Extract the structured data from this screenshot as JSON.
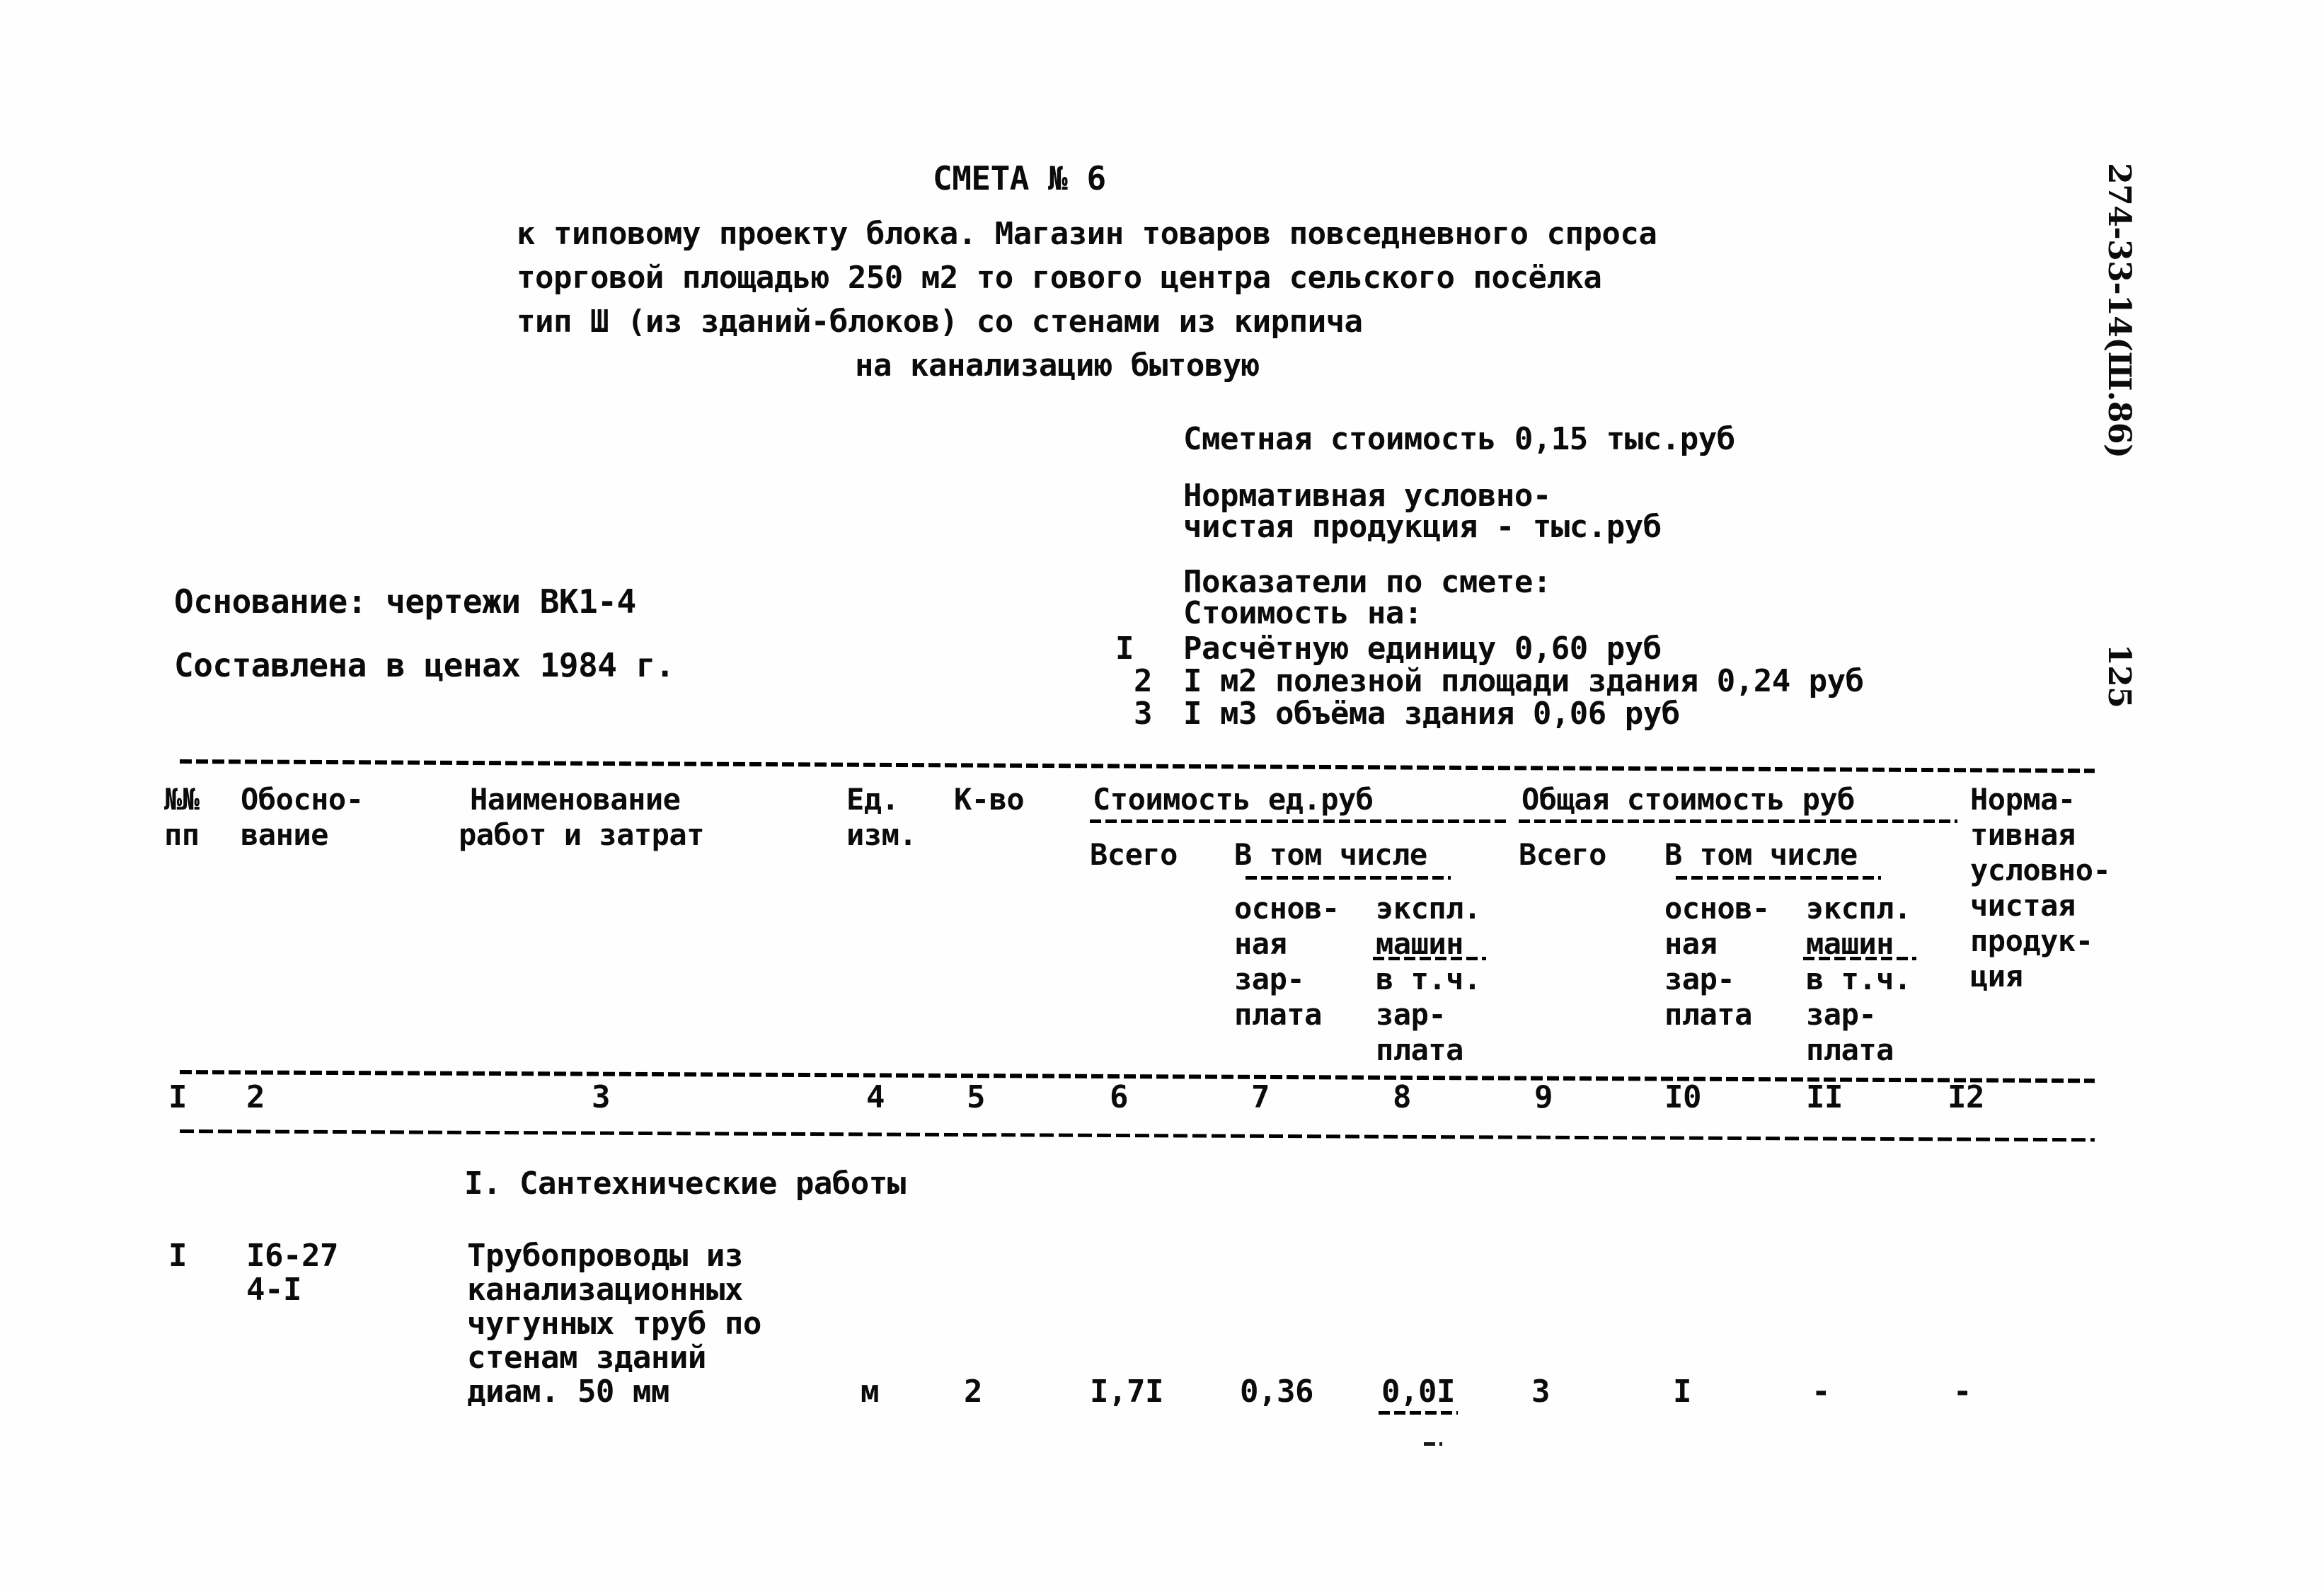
{
  "document": {
    "heading": "СМЕТА № 6",
    "subtitle_lines": [
      "к типовому проекту блока. Магазин товаров повседневного спроса",
      "торговой площадью 250 м2 то гового центра сельского посёлка",
      "тип Ш (из зданий-блоков) со стенами из кирпича"
    ],
    "subtitle_centered_line": "на канализацию бытовую",
    "side_code": "274-33-14(Ш.86)",
    "page_number": "125"
  },
  "basis": {
    "osnovanie": "Основание: чертежи ВК1-4",
    "prices": "Составлена в ценах 1984 г."
  },
  "summary": {
    "estimate_cost": "Сметная стоимость 0,15 тыс.руб",
    "npp_line1": "Нормативная условно-",
    "npp_line2": "чистая продукция - тыс.руб",
    "indicators_title": "Показатели по смете:",
    "cost_on": "Стоимость на:",
    "items": [
      {
        "no": "I",
        "text": "Расчётную единицу 0,60 руб"
      },
      {
        "no": "2",
        "text": "I м2 полезной площади здания 0,24 руб"
      },
      {
        "no": "3",
        "text": "I м3 объёма здания 0,06 руб"
      }
    ]
  },
  "table": {
    "headers": {
      "no_l1": "№№",
      "no_l2": "пп",
      "basis_l1": "Обосно-",
      "basis_l2": "вание",
      "name_l1": "Наименование",
      "name_l2": "работ и затрат",
      "unit_l1": "Ед.",
      "unit_l2": "изм.",
      "qty": "К-во",
      "group_unit_cost": "Стоимость ед.руб",
      "group_total_cost": "Общая стоимость руб",
      "total_1": "Всего",
      "incl_1": "В том числе",
      "total_2": "Всего",
      "incl_2": "В том числе",
      "sub_main_l1": "основ-",
      "sub_main_l2": "ная",
      "sub_main_l3": "зар-",
      "sub_main_l4": "плата",
      "sub_mach_l1": "экспл.",
      "sub_mach_l2": "машин",
      "sub_mach_l3": "в т.ч.",
      "sub_mach_l4": "зар-",
      "sub_mach_l5": "плата",
      "npp_l1": "Норма-",
      "npp_l2": "тивная",
      "npp_l3": "условно-",
      "npp_l4": "чистая",
      "npp_l5": "продук-",
      "npp_l6": "ция"
    },
    "column_numbers": [
      "I",
      "2",
      "3",
      "4",
      "5",
      "6",
      "7",
      "8",
      "9",
      "I0",
      "II",
      "I2"
    ],
    "section_title": "I. Сантехнические работы",
    "rows": [
      {
        "no": "I",
        "basis_l1": "I6-27",
        "basis_l2": "4-I",
        "name_l1": "Трубопроводы из",
        "name_l2": "канализационных",
        "name_l3": "чугунных труб по",
        "name_l4": "стенам зданий",
        "name_l5": "диам. 50 мм",
        "unit": "м",
        "qty": "2",
        "unit_total": "I,7I",
        "unit_main_salary": "0,36",
        "unit_machines": "0,0I",
        "total": "3",
        "total_main_salary": "I",
        "total_machines": "-",
        "npp": "-"
      }
    ]
  }
}
